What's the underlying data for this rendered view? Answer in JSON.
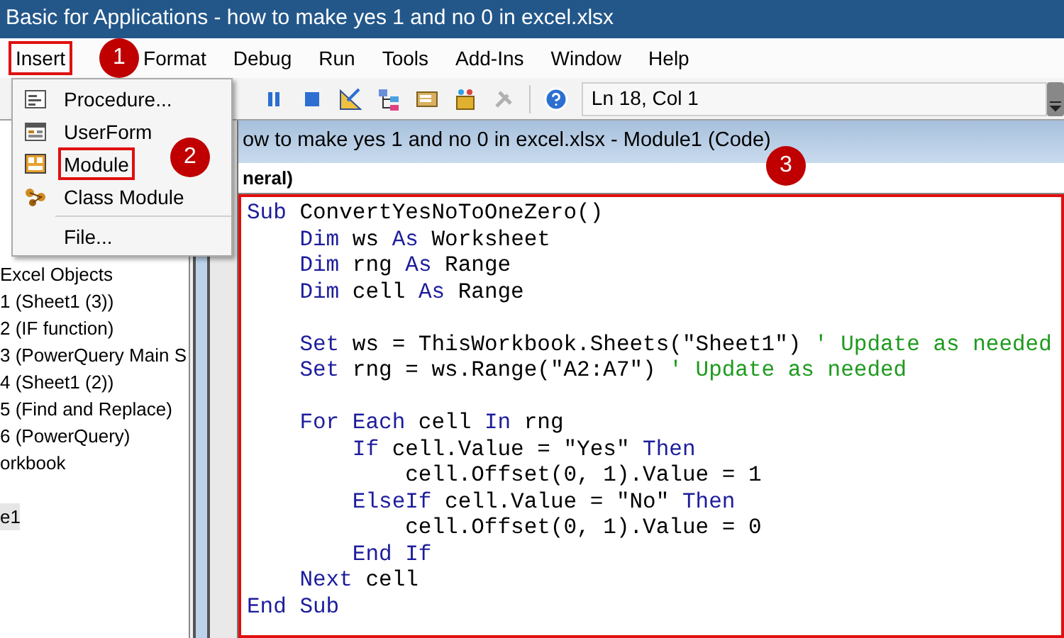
{
  "window": {
    "title": "Basic for Applications - how to make yes 1 and no 0 in excel.xlsx"
  },
  "menu_bar": [
    {
      "label": "Insert",
      "selected": true
    },
    {
      "label": "Format",
      "selected": false
    },
    {
      "label": "Debug",
      "selected": false
    },
    {
      "label": "Run",
      "selected": false
    },
    {
      "label": "Tools",
      "selected": false
    },
    {
      "label": "Add-Ins",
      "selected": false
    },
    {
      "label": "Window",
      "selected": false
    },
    {
      "label": "Help",
      "selected": false
    }
  ],
  "insert_menu": [
    {
      "label": "Procedure...",
      "kind": "procedure",
      "highlighted": false
    },
    {
      "label": "UserForm",
      "kind": "userform",
      "highlighted": false
    },
    {
      "label": "Module",
      "kind": "module",
      "highlighted": true
    },
    {
      "label": "Class Module",
      "kind": "class",
      "highlighted": false
    },
    {
      "label": "File...",
      "kind": "file",
      "highlighted": false
    }
  ],
  "toolbar": {
    "location": "Ln 18, Col 1"
  },
  "project_tree": [
    {
      "label": "Excel Objects",
      "selected": false
    },
    {
      "label": "1 (Sheet1 (3))",
      "selected": false
    },
    {
      "label": "2 (IF function)",
      "selected": false
    },
    {
      "label": "3 (PowerQuery Main S",
      "selected": false
    },
    {
      "label": "4 (Sheet1 (2))",
      "selected": false
    },
    {
      "label": "5 (Find and Replace)",
      "selected": false
    },
    {
      "label": "6 (PowerQuery)",
      "selected": false
    },
    {
      "label": "orkbook",
      "selected": false
    },
    {
      "label": "e1",
      "selected": true
    }
  ],
  "code_window": {
    "title": "ow to make yes 1 and no 0 in excel.xlsx - Module1 (Code)",
    "object_dropdown": "neral)",
    "highlighted": true,
    "lines": [
      {
        "kind": "code",
        "segments": [
          {
            "kind": "keyword",
            "text": "Sub"
          },
          {
            "kind": "plain",
            "text": " ConvertYesNoToOneZero()"
          }
        ]
      },
      {
        "kind": "code",
        "segments": [
          {
            "kind": "keyword",
            "text": "    Dim"
          },
          {
            "kind": "plain",
            "text": " ws "
          },
          {
            "kind": "keyword",
            "text": "As"
          },
          {
            "kind": "plain",
            "text": " Worksheet"
          }
        ]
      },
      {
        "kind": "code",
        "segments": [
          {
            "kind": "keyword",
            "text": "    Dim"
          },
          {
            "kind": "plain",
            "text": " rng "
          },
          {
            "kind": "keyword",
            "text": "As"
          },
          {
            "kind": "plain",
            "text": " Range"
          }
        ]
      },
      {
        "kind": "code",
        "segments": [
          {
            "kind": "keyword",
            "text": "    Dim"
          },
          {
            "kind": "plain",
            "text": " cell "
          },
          {
            "kind": "keyword",
            "text": "As"
          },
          {
            "kind": "plain",
            "text": " Range"
          }
        ]
      },
      {
        "kind": "blank"
      },
      {
        "kind": "code",
        "segments": [
          {
            "kind": "keyword",
            "text": "    Set"
          },
          {
            "kind": "plain",
            "text": " ws = ThisWorkbook.Sheets(\"Sheet1\") "
          },
          {
            "kind": "comment",
            "text": "' Update as needed"
          }
        ]
      },
      {
        "kind": "code",
        "segments": [
          {
            "kind": "keyword",
            "text": "    Set"
          },
          {
            "kind": "plain",
            "text": " rng = ws.Range(\"A2:A7\") "
          },
          {
            "kind": "comment",
            "text": "' Update as needed"
          }
        ]
      },
      {
        "kind": "blank"
      },
      {
        "kind": "code",
        "segments": [
          {
            "kind": "keyword",
            "text": "    For Each"
          },
          {
            "kind": "plain",
            "text": " cell "
          },
          {
            "kind": "keyword",
            "text": "In"
          },
          {
            "kind": "plain",
            "text": " rng"
          }
        ]
      },
      {
        "kind": "code",
        "segments": [
          {
            "kind": "keyword",
            "text": "        If"
          },
          {
            "kind": "plain",
            "text": " cell.Value = \"Yes\" "
          },
          {
            "kind": "keyword",
            "text": "Then"
          }
        ]
      },
      {
        "kind": "code",
        "segments": [
          {
            "kind": "plain",
            "text": "            cell.Offset(0, 1).Value = 1"
          }
        ]
      },
      {
        "kind": "code",
        "segments": [
          {
            "kind": "keyword",
            "text": "        ElseIf"
          },
          {
            "kind": "plain",
            "text": " cell.Value = \"No\" "
          },
          {
            "kind": "keyword",
            "text": "Then"
          }
        ]
      },
      {
        "kind": "code",
        "segments": [
          {
            "kind": "plain",
            "text": "            cell.Offset(0, 1).Value = 0"
          }
        ]
      },
      {
        "kind": "code",
        "segments": [
          {
            "kind": "keyword",
            "text": "        End If"
          }
        ]
      },
      {
        "kind": "code",
        "segments": [
          {
            "kind": "keyword",
            "text": "    Next"
          },
          {
            "kind": "plain",
            "text": " cell"
          }
        ]
      },
      {
        "kind": "code",
        "segments": [
          {
            "kind": "keyword",
            "text": "End Sub"
          }
        ]
      }
    ]
  },
  "annotations": [
    {
      "label": "1"
    },
    {
      "label": "2"
    },
    {
      "label": "3"
    }
  ]
}
